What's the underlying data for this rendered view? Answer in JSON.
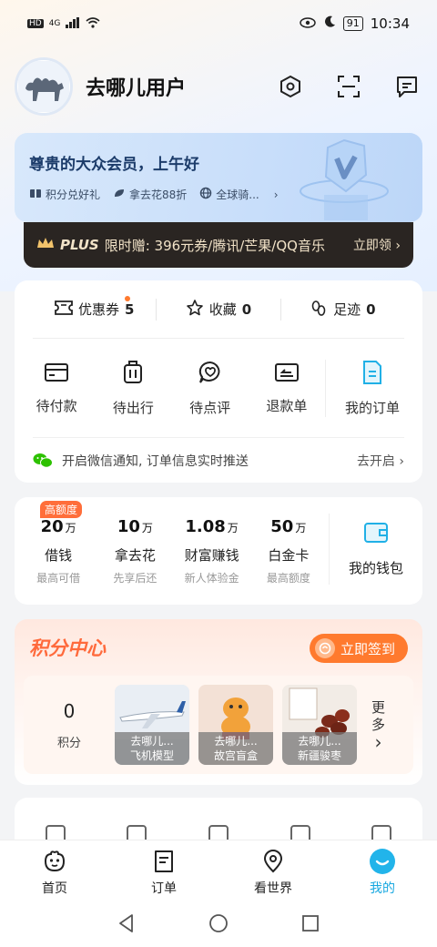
{
  "status_bar": {
    "left_icons": [
      "HD",
      "4G"
    ],
    "battery": "91",
    "time": "10:34"
  },
  "header": {
    "username": "去哪儿用户",
    "icons": [
      "settings-hex-icon",
      "scan-icon",
      "message-icon"
    ]
  },
  "member": {
    "title": "尊贵的大众会员，上午好",
    "perks": [
      {
        "label": "积分兑好礼",
        "icon": "gift-icon"
      },
      {
        "label": "拿去花88折",
        "icon": "leaf-icon"
      },
      {
        "label": "全球骑...",
        "icon": "globe-icon"
      }
    ],
    "more": "›"
  },
  "plus": {
    "tag": "PLUS",
    "text": "限时赠: 396元券/腾讯/芒果/QQ音乐",
    "cta": "立即领 ›"
  },
  "stats": [
    {
      "label": "优惠券",
      "count": "5",
      "icon": "coupon-icon",
      "dot": true
    },
    {
      "label": "收藏",
      "count": "0",
      "icon": "star-icon"
    },
    {
      "label": "足迹",
      "count": "0",
      "icon": "footprint-icon"
    }
  ],
  "orders": [
    {
      "label": "待付款",
      "icon": "wallet-card-icon"
    },
    {
      "label": "待出行",
      "icon": "luggage-icon"
    },
    {
      "label": "待点评",
      "icon": "review-icon"
    },
    {
      "label": "退款单",
      "icon": "refund-icon"
    },
    {
      "label": "我的订单",
      "icon": "order-list-icon"
    }
  ],
  "notify": {
    "text": "开启微信通知, 订单信息实时推送",
    "cta": "去开启 ›"
  },
  "wallet": {
    "items": [
      {
        "value": "20",
        "unit": "万",
        "name": "借钱",
        "sub": "最高可借",
        "badge": "高额度"
      },
      {
        "value": "10",
        "unit": "万",
        "name": "拿去花",
        "sub": "先享后还"
      },
      {
        "value": "1.08",
        "unit": "万",
        "name": "财富赚钱",
        "sub": "新人体验金"
      },
      {
        "value": "50",
        "unit": "万",
        "name": "白金卡",
        "sub": "最高额度"
      }
    ],
    "mine": "我的钱包"
  },
  "points": {
    "title": "积分中心",
    "checkin": "立即签到",
    "count": "0",
    "count_label": "积分",
    "products": [
      {
        "brand": "去哪儿...",
        "name": "飞机模型"
      },
      {
        "brand": "去哪儿...",
        "name": "故宫盲盒"
      },
      {
        "brand": "去哪儿...",
        "name": "新疆骏枣"
      }
    ],
    "more_line1": "更",
    "more_line2": "多",
    "more_arrow": "›"
  },
  "tabs": [
    {
      "label": "首页",
      "icon": "home-camel-icon"
    },
    {
      "label": "订单",
      "icon": "order-tab-icon"
    },
    {
      "label": "看世界",
      "icon": "location-pin-icon"
    },
    {
      "label": "我的",
      "icon": "profile-smile-icon",
      "active": true
    }
  ],
  "colors": {
    "accent": "#18a8e0",
    "orange": "#ff7a2e",
    "plus_bg": "#2a2522"
  }
}
